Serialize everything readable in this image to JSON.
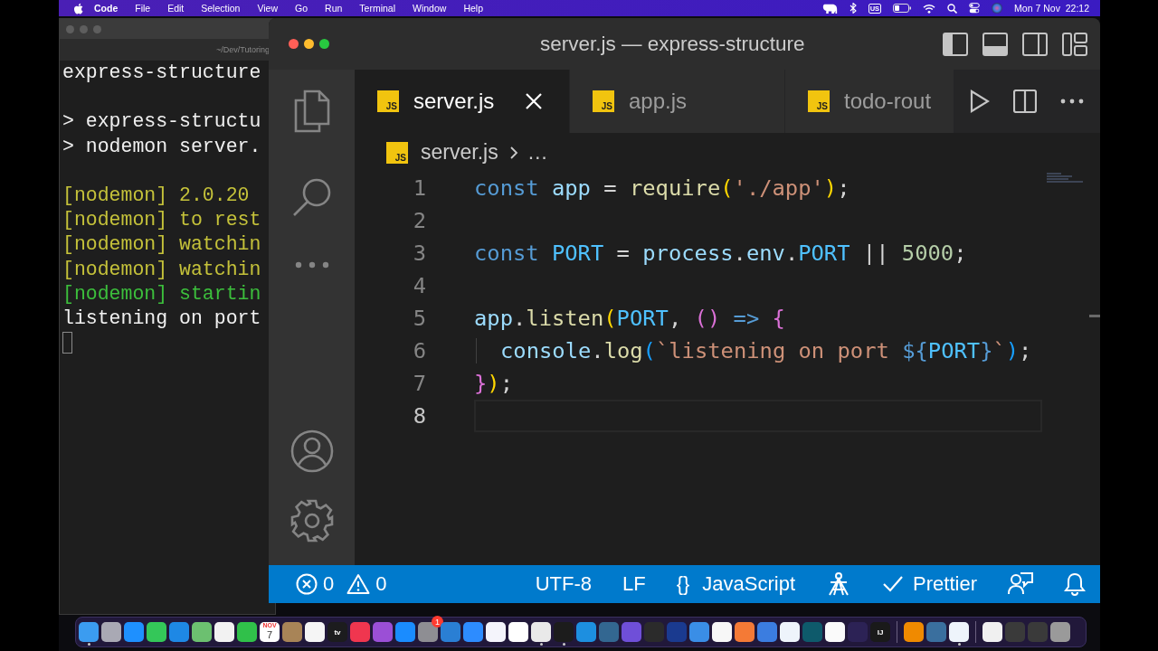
{
  "menu_bar": {
    "app": "Code",
    "menus": [
      "File",
      "Edit",
      "Selection",
      "View",
      "Go",
      "Run",
      "Terminal",
      "Window",
      "Help"
    ],
    "input_source": "US",
    "clock": "Mon 7 Nov  22:12"
  },
  "terminal": {
    "path": "~/Dev/Tutoring",
    "lines": [
      {
        "kind": "plain",
        "text": "express-structure"
      },
      {
        "kind": "blank"
      },
      {
        "kind": "plain",
        "text": "> express-structu"
      },
      {
        "kind": "plain",
        "text": "> nodemon server."
      },
      {
        "kind": "blank"
      },
      {
        "kind": "info",
        "text": "[nodemon] 2.0.20"
      },
      {
        "kind": "info",
        "text": "[nodemon] to rest"
      },
      {
        "kind": "info",
        "text": "[nodemon] watchin"
      },
      {
        "kind": "info",
        "text": "[nodemon] watchin"
      },
      {
        "kind": "success",
        "text": "[nodemon] startin"
      },
      {
        "kind": "plain",
        "text": "listening on port"
      },
      {
        "kind": "cursor"
      }
    ]
  },
  "editor": {
    "title": "server.js — express-structure",
    "tabs": [
      {
        "label": "server.js",
        "file_badge": "JS",
        "selected": true
      },
      {
        "label": "app.js",
        "file_badge": "JS",
        "selected": false
      },
      {
        "label": "todo-rout",
        "file_badge": "JS",
        "selected": false
      }
    ],
    "breadcrumb": {
      "file_badge": "JS",
      "items": [
        "server.js",
        "…"
      ]
    },
    "lines": [
      {
        "number": "1",
        "current": false,
        "tokens": [
          {
            "kind": "keyword",
            "text": "const "
          },
          {
            "kind": "variable",
            "text": "app"
          },
          {
            "kind": "plain",
            "text": " = "
          },
          {
            "kind": "function",
            "text": "require"
          },
          {
            "kind": "bracket1",
            "text": "("
          },
          {
            "kind": "string",
            "text": "'./app'"
          },
          {
            "kind": "bracket1",
            "text": ")"
          },
          {
            "kind": "plain",
            "text": ";"
          }
        ]
      },
      {
        "number": "2",
        "current": false
      },
      {
        "number": "3",
        "current": false,
        "tokens": [
          {
            "kind": "keyword",
            "text": "const "
          },
          {
            "kind": "constant",
            "text": "PORT"
          },
          {
            "kind": "plain",
            "text": " = "
          },
          {
            "kind": "variable",
            "text": "process"
          },
          {
            "kind": "plain",
            "text": "."
          },
          {
            "kind": "variable",
            "text": "env"
          },
          {
            "kind": "plain",
            "text": "."
          },
          {
            "kind": "constant",
            "text": "PORT"
          },
          {
            "kind": "plain",
            "text": " || "
          },
          {
            "kind": "number",
            "text": "5000"
          },
          {
            "kind": "plain",
            "text": ";"
          }
        ]
      },
      {
        "number": "4",
        "current": false
      },
      {
        "number": "5",
        "current": false,
        "tokens": [
          {
            "kind": "variable",
            "text": "app"
          },
          {
            "kind": "plain",
            "text": "."
          },
          {
            "kind": "function",
            "text": "listen"
          },
          {
            "kind": "bracket1",
            "text": "("
          },
          {
            "kind": "constant",
            "text": "PORT"
          },
          {
            "kind": "plain",
            "text": ", "
          },
          {
            "kind": "bracket2",
            "text": "() "
          },
          {
            "kind": "keyword",
            "text": "=> "
          },
          {
            "kind": "bracket2",
            "text": "{"
          }
        ]
      },
      {
        "number": "6",
        "current": false,
        "indented": true,
        "tokens": [
          {
            "kind": "variable",
            "text": "console"
          },
          {
            "kind": "plain",
            "text": "."
          },
          {
            "kind": "function",
            "text": "log"
          },
          {
            "kind": "bracket3",
            "text": "("
          },
          {
            "kind": "string",
            "text": "`listening on port "
          },
          {
            "kind": "template",
            "text": "${"
          },
          {
            "kind": "constant",
            "text": "PORT"
          },
          {
            "kind": "template",
            "text": "}"
          },
          {
            "kind": "string",
            "text": "`"
          },
          {
            "kind": "bracket3",
            "text": ")"
          },
          {
            "kind": "plain",
            "text": ";"
          }
        ]
      },
      {
        "number": "7",
        "current": false,
        "tokens": [
          {
            "kind": "bracket2",
            "text": "}"
          },
          {
            "kind": "bracket1",
            "text": ")"
          },
          {
            "kind": "plain",
            "text": ";"
          }
        ]
      },
      {
        "number": "8",
        "current": true
      }
    ]
  },
  "status_bar": {
    "errors": "0",
    "warnings": "0",
    "encoding": "UTF-8",
    "eol": "LF",
    "language_icon": "{}",
    "language": "JavaScript",
    "formatter": "Prettier"
  },
  "dock": {
    "sections": [
      {
        "items": [
          {
            "kind": "app",
            "color": "#3b9cf0",
            "running": true
          },
          {
            "kind": "app",
            "color": "#a9a9b4",
            "running": false
          },
          {
            "kind": "app",
            "color": "#1e90ff",
            "running": false
          },
          {
            "kind": "app",
            "color": "#34c759",
            "running": false
          },
          {
            "kind": "app",
            "color": "#1e88e5",
            "running": false
          },
          {
            "kind": "app",
            "color": "#6cc070",
            "running": false
          },
          {
            "kind": "app",
            "color": "#f2f2f2",
            "running": false
          },
          {
            "kind": "app",
            "color": "#30c04a",
            "running": false
          },
          {
            "kind": "calendar",
            "color": "#ffffff",
            "month": "NOV",
            "day": "7",
            "running": false
          },
          {
            "kind": "app",
            "color": "#a88457",
            "running": false
          },
          {
            "kind": "app",
            "color": "#f5f5f5",
            "running": false
          },
          {
            "kind": "app",
            "color": "#1c1c1e",
            "label": "tv",
            "running": false
          },
          {
            "kind": "app",
            "color": "#f0364f",
            "running": false
          },
          {
            "kind": "app",
            "color": "#9b4fd6",
            "running": false
          },
          {
            "kind": "app",
            "color": "#1a8cff",
            "running": false
          },
          {
            "kind": "app",
            "color": "#8e8e93",
            "badge": "1",
            "running": false
          },
          {
            "kind": "app",
            "color": "#2a7fd4",
            "running": false
          },
          {
            "kind": "app",
            "color": "#2d8cff",
            "running": false
          },
          {
            "kind": "app",
            "color": "#f4f4fb",
            "running": false
          },
          {
            "kind": "app",
            "color": "#ffffff",
            "running": false
          },
          {
            "kind": "app",
            "color": "#e9e9e9",
            "running": true
          },
          {
            "kind": "app",
            "color": "#1c1c1c",
            "running": true
          },
          {
            "kind": "app",
            "color": "#1d8fe0",
            "running": false
          },
          {
            "kind": "app",
            "color": "#336791",
            "running": false
          },
          {
            "kind": "app",
            "color": "#6f4fd8",
            "running": false
          },
          {
            "kind": "app",
            "color": "#2b2b2b",
            "running": false
          },
          {
            "kind": "app",
            "color": "#1a3a8f",
            "running": false
          },
          {
            "kind": "app",
            "color": "#3a8ee6",
            "running": false
          },
          {
            "kind": "app",
            "color": "#f7f7f7",
            "running": false
          },
          {
            "kind": "app",
            "color": "#f47a36",
            "running": false
          },
          {
            "kind": "app",
            "color": "#3b7de0",
            "running": false
          },
          {
            "kind": "app",
            "color": "#eef4fb",
            "running": false
          },
          {
            "kind": "app",
            "color": "#0e5a6b",
            "running": false
          },
          {
            "kind": "app",
            "color": "#fafafa",
            "running": false
          },
          {
            "kind": "app",
            "color": "#2c2255",
            "running": false
          },
          {
            "kind": "app",
            "color": "#1a1a1a",
            "label": "IJ",
            "running": false
          }
        ]
      },
      {
        "items": [
          {
            "kind": "app",
            "color": "#f08a00",
            "running": false
          },
          {
            "kind": "app",
            "color": "#3a6f9e",
            "running": false
          },
          {
            "kind": "app",
            "color": "#eef4fb",
            "running": true
          }
        ]
      },
      {
        "items": [
          {
            "kind": "app",
            "color": "#f0f0f0",
            "running": false
          },
          {
            "kind": "app",
            "color": "#3a3a3a",
            "running": false
          },
          {
            "kind": "app",
            "color": "#3a3a3a",
            "running": false
          },
          {
            "kind": "app",
            "color": "#9a9a9a",
            "running": false
          }
        ]
      }
    ]
  }
}
